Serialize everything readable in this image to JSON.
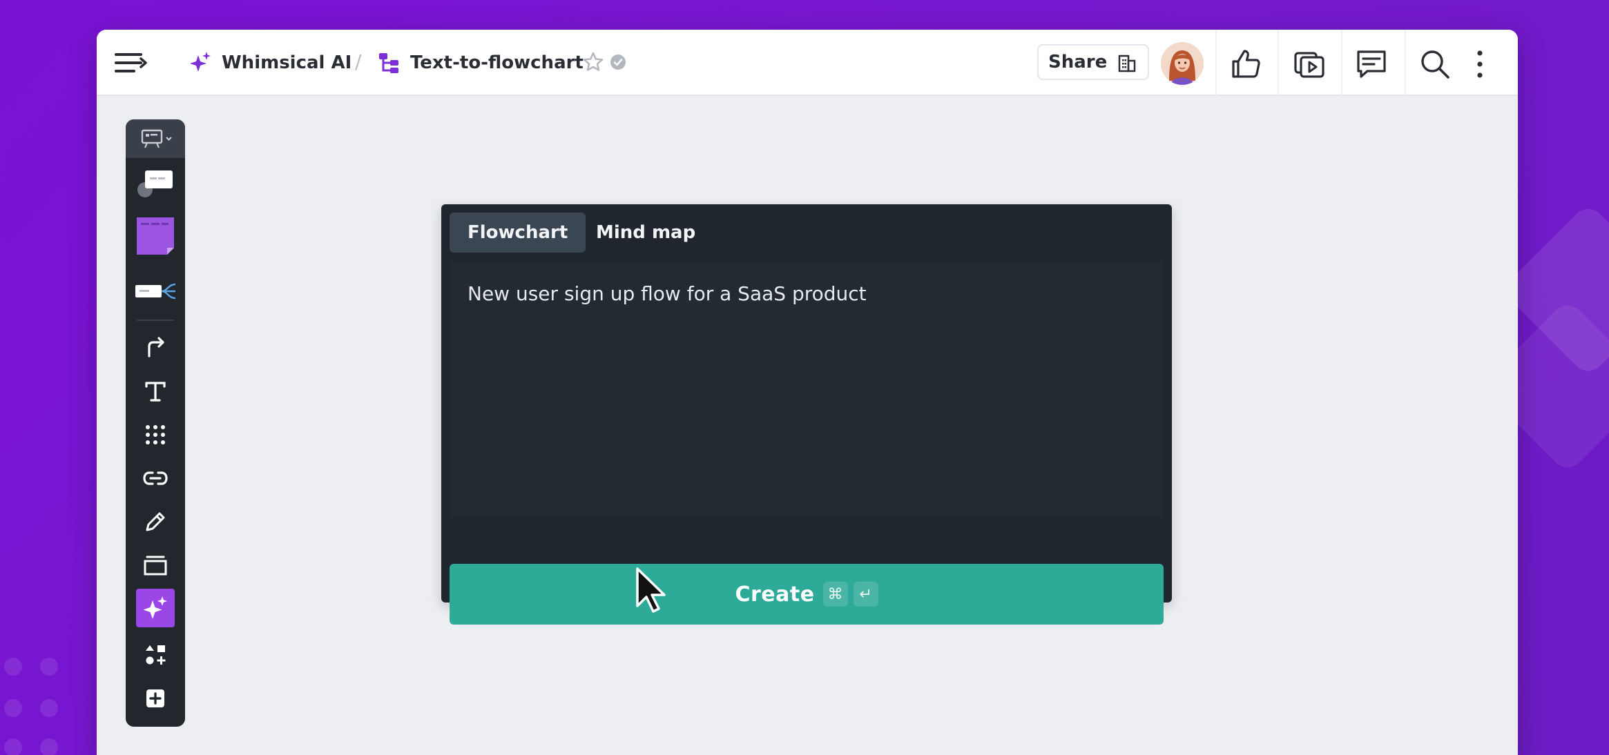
{
  "header": {
    "breadcrumb": [
      {
        "label": "Whimsical AI",
        "icon": "sparkle-icon"
      },
      {
        "label": "Text-to-flowchart",
        "icon": "flowchart-icon"
      }
    ],
    "separator": "/",
    "share_label": "Share"
  },
  "toolbar": {
    "tools": [
      "board-switcher-icon",
      "card-icon",
      "sticky-note-icon",
      "mindmap-icon",
      "connector-icon",
      "text-tool-icon",
      "grid-icon",
      "link-icon",
      "pencil-icon",
      "frame-icon",
      "ai-sparkle-icon",
      "shapes-icon",
      "add-icon"
    ],
    "active_tool": "ai-sparkle-icon"
  },
  "dialog": {
    "tabs": [
      {
        "label": "Flowchart",
        "active": true
      },
      {
        "label": "Mind map",
        "active": false
      }
    ],
    "prompt_value": "New user sign up flow for a SaaS product",
    "create_label": "Create",
    "shortcut_keys": [
      "⌘",
      "↵"
    ]
  },
  "colors": {
    "background": "#7a12d4",
    "accent": "#7b2fd6",
    "create_button": "#2eaa98",
    "dialog_bg": "#1f262e"
  }
}
